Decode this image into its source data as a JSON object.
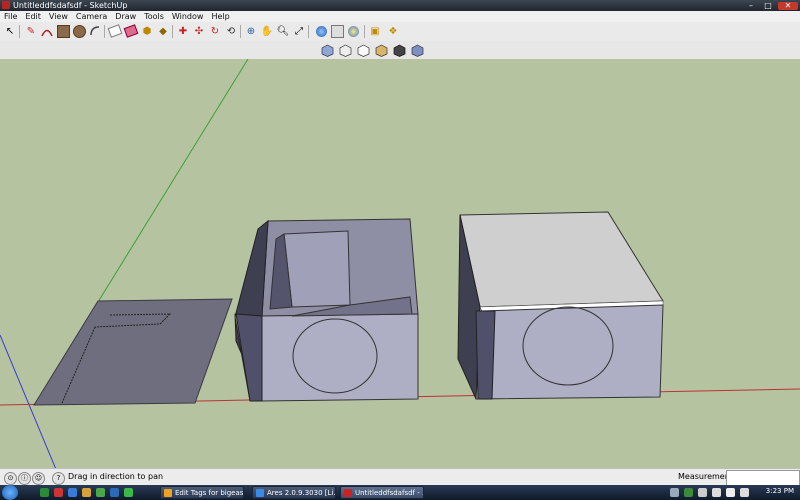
{
  "window": {
    "title": "Untitleddfsdafsdf - SketchUp"
  },
  "menu": [
    "File",
    "Edit",
    "View",
    "Camera",
    "Draw",
    "Tools",
    "Window",
    "Help"
  ],
  "toolbar_icons": [
    "select-icon",
    "pencil-line-icon",
    "arc-icon",
    "rectangle-icon",
    "circle-icon",
    "polygon-icon",
    "eraser-icon",
    "tape-measure-icon",
    "paint-bucket-icon",
    "push-pull-icon",
    "move-icon",
    "rotate-icon",
    "follow-me-icon",
    "offset-icon",
    "orbit-icon",
    "pan-icon",
    "zoom-icon",
    "zoom-extents-icon",
    "previous-view-icon",
    "next-view-icon",
    "get-models-icon",
    "share-model-icon",
    "components-icon",
    "google-earth-icon"
  ],
  "view_icons": [
    "iso-view-icon",
    "top-view-icon",
    "front-view-icon",
    "right-view-icon",
    "back-view-icon",
    "left-view-icon"
  ],
  "status": {
    "message": "Drag in direction to pan",
    "measurements_label": "Measurements",
    "measurements_value": ""
  },
  "taskbar": {
    "tasks": [
      "Edit Tags for bigeas...",
      "Ares 2.0.9.3030 [Li...",
      "Untitleddfsdafsdf - ..."
    ],
    "clock": "3:23 PM"
  },
  "colors": {
    "viewport_bg": "#b6c3a1",
    "box_face": "#a9a8c0",
    "box_dark": "#5a5a6e",
    "lid": "#cfcfcf"
  }
}
